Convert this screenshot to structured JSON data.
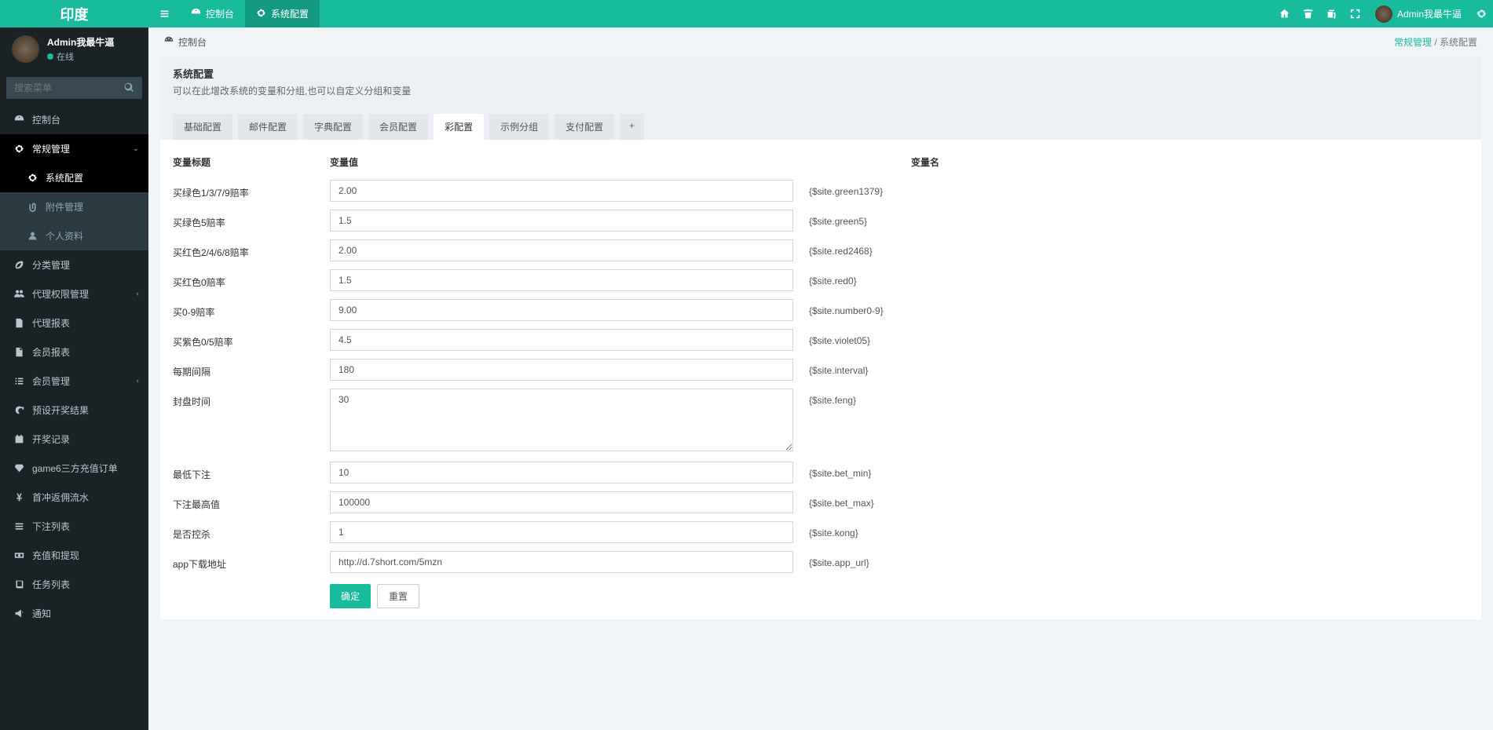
{
  "brand": "印度",
  "user": {
    "name": "Admin我最牛逼",
    "status": "在线"
  },
  "search": {
    "placeholder": "搜索菜单"
  },
  "top_tabs": [
    {
      "label": "控制台",
      "icon": "dashboard"
    },
    {
      "label": "系统配置",
      "icon": "gear",
      "active": true
    }
  ],
  "top_user": "Admin我最牛逼",
  "sidebar": [
    {
      "label": "控制台",
      "icon": "dashboard"
    },
    {
      "label": "常规管理",
      "icon": "gear",
      "active_p": true,
      "arrow": "down"
    },
    {
      "label": "系统配置",
      "icon": "gear",
      "sub": true,
      "active_sub": true
    },
    {
      "label": "附件管理",
      "icon": "clip",
      "sub": true
    },
    {
      "label": "个人资料",
      "icon": "user",
      "sub": true
    },
    {
      "label": "分类管理",
      "icon": "leaf"
    },
    {
      "label": "代理权限管理",
      "icon": "users",
      "arrow": "left"
    },
    {
      "label": "代理报表",
      "icon": "doc"
    },
    {
      "label": "会员报表",
      "icon": "file"
    },
    {
      "label": "会员管理",
      "icon": "list",
      "arrow": "left"
    },
    {
      "label": "预设开奖结果",
      "icon": "refresh"
    },
    {
      "label": "开奖记录",
      "icon": "calendar"
    },
    {
      "label": "game6三方充值订单",
      "icon": "diamond"
    },
    {
      "label": "首冲返佣流水",
      "icon": "yen"
    },
    {
      "label": "下注列表",
      "icon": "bars"
    },
    {
      "label": "充值和提现",
      "icon": "money"
    },
    {
      "label": "任务列表",
      "icon": "book"
    },
    {
      "label": "通知",
      "icon": "horn"
    }
  ],
  "breadcrumb": {
    "home": "控制台",
    "path1": "常规管理",
    "path2": "系统配置"
  },
  "panel": {
    "title": "系统配置",
    "desc": "可以在此增改系统的变量和分组,也可以自定义分组和变量"
  },
  "config_tabs": [
    "基础配置",
    "邮件配置",
    "字典配置",
    "会员配置",
    "彩配置",
    "示例分组",
    "支付配置"
  ],
  "config_tab_active": 4,
  "table_head": {
    "title": "变量标题",
    "value": "变量值",
    "name": "变量名"
  },
  "rows": [
    {
      "title": "买绿色1/3/7/9赔率",
      "value": "2.00",
      "name": "{$site.green1379}"
    },
    {
      "title": "买绿色5赔率",
      "value": "1.5",
      "name": "{$site.green5}"
    },
    {
      "title": "买红色2/4/6/8赔率",
      "value": "2.00",
      "name": "{$site.red2468}"
    },
    {
      "title": "买红色0赔率",
      "value": "1.5",
      "name": "{$site.red0}"
    },
    {
      "title": "买0-9赔率",
      "value": "9.00",
      "name": "{$site.number0-9}"
    },
    {
      "title": "买紫色0/5赔率",
      "value": "4.5",
      "name": "{$site.violet05}"
    },
    {
      "title": "每期间隔",
      "value": "180",
      "name": "{$site.interval}"
    },
    {
      "title": "封盘时间",
      "value": "30",
      "name": "{$site.feng}",
      "textarea": true
    },
    {
      "title": "最低下注",
      "value": "10",
      "name": "{$site.bet_min}"
    },
    {
      "title": "下注最高值",
      "value": "100000",
      "name": "{$site.bet_max}"
    },
    {
      "title": "是否控杀",
      "value": "1",
      "name": "{$site.kong}"
    },
    {
      "title": "app下载地址",
      "value": "http://d.7short.com/5mzn",
      "name": "{$site.app_url}"
    }
  ],
  "buttons": {
    "ok": "确定",
    "reset": "重置"
  }
}
